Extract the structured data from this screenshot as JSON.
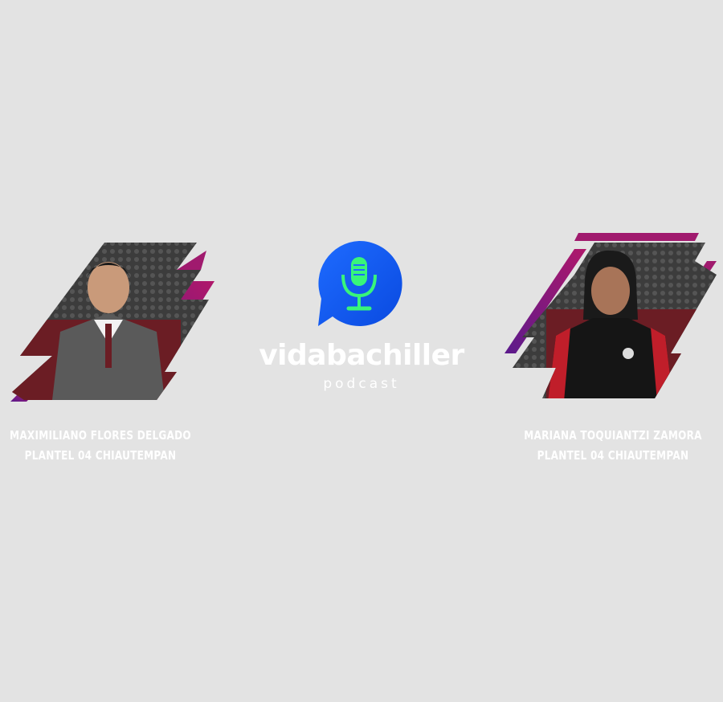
{
  "guests": [
    {
      "name": "MAXIMILIANO FLORES DELGADO",
      "school": "PLANTEL 04 CHIAUTEMPAN"
    },
    {
      "name": "MARIANA TOQUIANTZI ZAMORA",
      "school": "PLANTEL 04 CHIAUTEMPAN"
    }
  ],
  "logo": {
    "wordmark": "vidabachiller",
    "subtitle": "podcast",
    "icon": "microphone-icon"
  },
  "colors": {
    "background": "#e3e3e3",
    "accent_purple": "#6a1b8a",
    "accent_magenta": "#a01a6e",
    "logo_blue": "#1e6bff",
    "logo_green": "#38f57a"
  }
}
